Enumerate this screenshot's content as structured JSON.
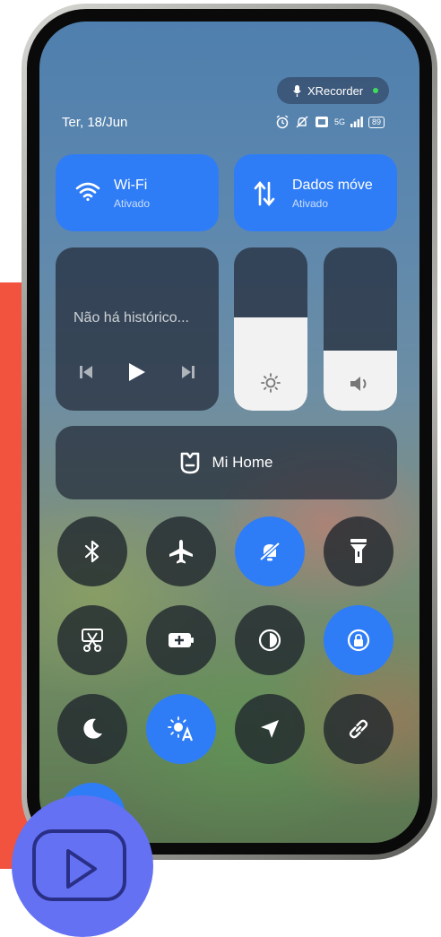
{
  "status_bar": {
    "recorder_label": "XRecorder",
    "date": "Ter, 18/Jun",
    "signal_label": "5G",
    "battery": "89"
  },
  "wifi": {
    "title": "Wi-Fi",
    "subtitle": "Ativado",
    "icon": "wifi-icon"
  },
  "mobile_data": {
    "title": "Dados móve",
    "subtitle": "Ativado",
    "icon": "data-arrows-icon"
  },
  "media": {
    "text": "Não há histórico..."
  },
  "brightness": {
    "level": 0.57,
    "icon": "sun-icon"
  },
  "volume": {
    "level": 0.37,
    "icon": "speaker-icon"
  },
  "mi_home": {
    "label": "Mi Home",
    "icon": "mi-home-icon"
  },
  "toggles": [
    {
      "name": "bluetooth",
      "icon": "bluetooth-icon",
      "active": false
    },
    {
      "name": "airplane",
      "icon": "airplane-icon",
      "active": false
    },
    {
      "name": "silent",
      "icon": "bell-off-icon",
      "active": true
    },
    {
      "name": "flashlight",
      "icon": "flashlight-icon",
      "active": false
    },
    {
      "name": "screenshot",
      "icon": "scissors-icon",
      "active": false
    },
    {
      "name": "battery-saver",
      "icon": "battery-plus-icon",
      "active": false
    },
    {
      "name": "dark-mode",
      "icon": "contrast-icon",
      "active": false
    },
    {
      "name": "rotation-lock",
      "icon": "rotation-lock-icon",
      "active": true
    },
    {
      "name": "night-mode",
      "icon": "moon-icon",
      "active": false
    },
    {
      "name": "auto-brightness",
      "icon": "auto-brightness-icon",
      "active": true
    },
    {
      "name": "location",
      "icon": "location-arrow-icon",
      "active": false
    },
    {
      "name": "link",
      "icon": "link-icon",
      "active": false
    }
  ],
  "colors": {
    "accent": "#2f7df6",
    "background_red": "#f2533e",
    "youtube_circle": "#6471f2"
  }
}
